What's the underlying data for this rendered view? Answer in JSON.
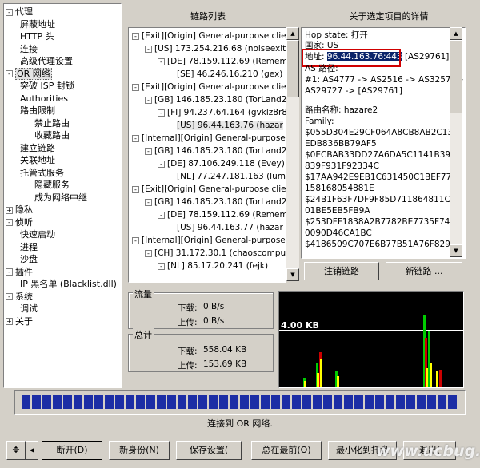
{
  "nav": {
    "items": [
      {
        "label": "代理",
        "toggle": "-",
        "level": 0
      },
      {
        "label": "屏蔽地址",
        "level": 1
      },
      {
        "label": "HTTP 头",
        "level": 1
      },
      {
        "label": "连接",
        "level": 1
      },
      {
        "label": "高级代理设置",
        "level": 1
      },
      {
        "label": "OR 网络",
        "toggle": "-",
        "level": 0,
        "selected": true
      },
      {
        "label": "突破 ISP 封锁",
        "level": 1
      },
      {
        "label": "Authorities",
        "level": 1
      },
      {
        "label": "路由限制",
        "level": 1
      },
      {
        "label": "禁止路由",
        "level": 2
      },
      {
        "label": "收藏路由",
        "level": 2
      },
      {
        "label": "建立链路",
        "level": 1
      },
      {
        "label": "关联地址",
        "level": 1
      },
      {
        "label": "托管式服务",
        "level": 1
      },
      {
        "label": "隐藏服务",
        "level": 2
      },
      {
        "label": "成为网络中继",
        "level": 2
      },
      {
        "label": "隐私",
        "toggle": "+",
        "level": 0
      },
      {
        "label": "侦听",
        "toggle": "-",
        "level": 0
      },
      {
        "label": "快速启动",
        "level": 1
      },
      {
        "label": "进程",
        "level": 1
      },
      {
        "label": "沙盘",
        "level": 1
      },
      {
        "label": "插件",
        "toggle": "-",
        "level": 0
      },
      {
        "label": "IP 黑名单 (Blacklist.dll)",
        "level": 1
      },
      {
        "label": "系统",
        "toggle": "-",
        "level": 0
      },
      {
        "label": "调试",
        "level": 1
      },
      {
        "label": "关于",
        "toggle": "+",
        "level": 0
      }
    ]
  },
  "circuit_panel": {
    "title": "链路列表",
    "lines": [
      {
        "indent": 0,
        "toggle": "-",
        "text": "[Exit][Origin] General-purpose client_"
      },
      {
        "indent": 1,
        "toggle": "-",
        "text": "[US] 173.254.216.68 (noiseexit01"
      },
      {
        "indent": 2,
        "toggle": "-",
        "text": "[DE] 78.159.112.69 (Rememb"
      },
      {
        "indent": 3,
        "text": "[SE] 46.246.16.210 (gex)"
      },
      {
        "indent": 0,
        "toggle": "-",
        "text": "[Exit][Origin] General-purpose client_"
      },
      {
        "indent": 1,
        "toggle": "-",
        "text": "[GB] 146.185.23.180 (TorLand2)"
      },
      {
        "indent": 2,
        "toggle": "-",
        "text": "[FI] 94.237.64.164 (gvklz8r89"
      },
      {
        "indent": 3,
        "text": "[US] 96.44.163.76 (hazar",
        "selected": true
      },
      {
        "indent": 0,
        "toggle": "-",
        "text": "[Internal][Origin] General-purpose clie"
      },
      {
        "indent": 1,
        "toggle": "-",
        "text": "[GB] 146.185.23.180 (TorLand2)"
      },
      {
        "indent": 2,
        "toggle": "-",
        "text": "[DE] 87.106.249.118 (Evey)"
      },
      {
        "indent": 3,
        "text": "[NL] 77.247.181.163 (lum"
      },
      {
        "indent": 0,
        "toggle": "-",
        "text": "[Exit][Origin] General-purpose client_"
      },
      {
        "indent": 1,
        "toggle": "-",
        "text": "[GB] 146.185.23.180 (TorLand2)"
      },
      {
        "indent": 2,
        "toggle": "-",
        "text": "[DE] 78.159.112.69 (Rememb"
      },
      {
        "indent": 3,
        "text": "[US] 96.44.163.77 (hazar"
      },
      {
        "indent": 0,
        "toggle": "-",
        "text": "[Internal][Origin] General-purpose clie"
      },
      {
        "indent": 1,
        "toggle": "-",
        "text": "[CH] 31.172.30.1 (chaoscompute"
      },
      {
        "indent": 2,
        "toggle": "-",
        "text": "[NL] 85.17.20.241 (fejk)"
      }
    ]
  },
  "details_panel": {
    "title": "关于选定项目的详情",
    "hop_state": "Hop state: 打开",
    "country": "国家: US",
    "address_label": "地址:",
    "address_value": "96.44.163.76:443",
    "address_as": "[AS29761]",
    "as_path_label": "AS 路径:",
    "as_path_1": "#1: AS4777 -> AS2516 -> AS3257 ->",
    "as_path_2": "AS29727 -> [AS29761]",
    "router_name": "路由名称: hazare2",
    "family_label": "Family:",
    "family": [
      "$055D304E29CF064A8CB8AB2C13A",
      "EDB836BB79AF5",
      "$0ECBAB33DD27A6DA5C1141B39F",
      "839F931F92334C",
      "$17AA942E9EB1C631450C1BEF77C",
      "158168054881E",
      "$24B1F63F7DF9F85D711864811CC4",
      "01BE5EB5FB9A",
      "$253DFF1838A2B7782BE7735F74E5",
      "0090D46CA1BC",
      "$4186509C707E6B77B51A76F8294"
    ]
  },
  "actions": {
    "close_circuit": "注销链路",
    "new_circuit": "新链路 ..."
  },
  "traffic": {
    "group_label": "流量",
    "down_label": "下载:",
    "down_value": "0 B/s",
    "up_label": "上传:",
    "up_value": "0 B/s",
    "total_label": "总计",
    "total_down_label": "下载:",
    "total_down_value": "558.04 KB",
    "total_up_label": "上传:",
    "total_up_value": "153.69 KB"
  },
  "graph": {
    "label": "4.00 KB",
    "colors": {
      "line": "#ffffff",
      "red": "#cc0000",
      "green": "#00cc00",
      "yellow": "#ffff00"
    }
  },
  "status": {
    "text": "连接到 OR 网络.",
    "progress": 1.0
  },
  "toolbar": {
    "disconnect": "断开(D)",
    "new_identity": "新身份(N)",
    "save_settings": "保存设置(",
    "always_on_top": "总在最前(O)",
    "minimize_to_tray": "最小化到托盘",
    "exit": "退出(",
    "nav_arrows_icon": "move-arrows-icon",
    "prev_icon": "left-arrow-icon",
    "next_icon": "right-arrow-icon"
  },
  "watermark": "www.ucbug.cc"
}
